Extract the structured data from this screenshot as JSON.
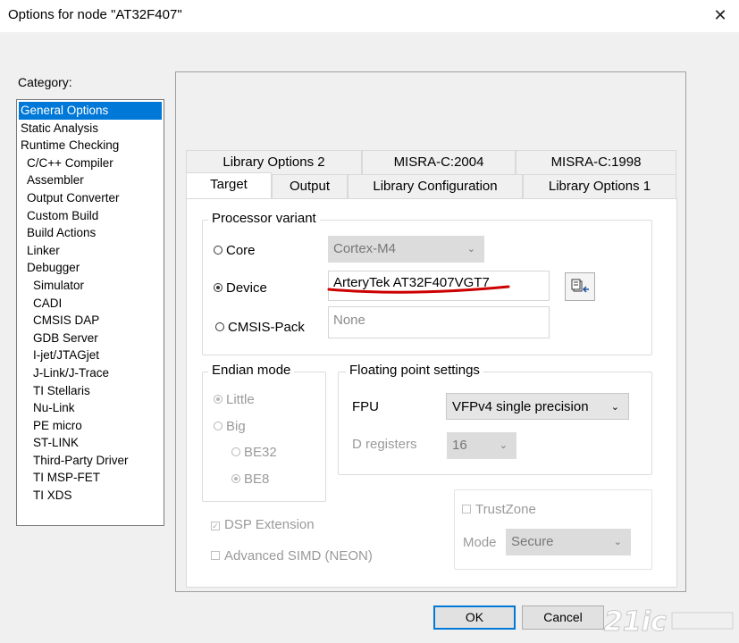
{
  "window": {
    "title": "Options for node \"AT32F407\"",
    "close_symbol": "✕"
  },
  "category": {
    "label": "Category:",
    "items": [
      {
        "label": "General Options",
        "level": 0,
        "selected": true
      },
      {
        "label": "Static Analysis",
        "level": 0
      },
      {
        "label": "Runtime Checking",
        "level": 0
      },
      {
        "label": "C/C++ Compiler",
        "level": 1
      },
      {
        "label": "Assembler",
        "level": 1
      },
      {
        "label": "Output Converter",
        "level": 1
      },
      {
        "label": "Custom Build",
        "level": 1
      },
      {
        "label": "Build Actions",
        "level": 1
      },
      {
        "label": "Linker",
        "level": 1
      },
      {
        "label": "Debugger",
        "level": 1
      },
      {
        "label": "Simulator",
        "level": 2
      },
      {
        "label": "CADI",
        "level": 2
      },
      {
        "label": "CMSIS DAP",
        "level": 2
      },
      {
        "label": "GDB Server",
        "level": 2
      },
      {
        "label": "I-jet/JTAGjet",
        "level": 2
      },
      {
        "label": "J-Link/J-Trace",
        "level": 2
      },
      {
        "label": "TI Stellaris",
        "level": 2
      },
      {
        "label": "Nu-Link",
        "level": 2
      },
      {
        "label": "PE micro",
        "level": 2
      },
      {
        "label": "ST-LINK",
        "level": 2
      },
      {
        "label": "Third-Party Driver",
        "level": 2
      },
      {
        "label": "TI MSP-FET",
        "level": 2
      },
      {
        "label": "TI XDS",
        "level": 2
      }
    ]
  },
  "tabs": {
    "row_back": [
      "Library Options 2",
      "MISRA-C:2004",
      "MISRA-C:1998"
    ],
    "row_front": [
      "Target",
      "Output",
      "Library Configuration",
      "Library Options 1"
    ],
    "active": "Target"
  },
  "processor_variant": {
    "title": "Processor variant",
    "core_label": "Core",
    "core_value": "Cortex-M4",
    "device_label": "Device",
    "device_value": "ArteryTek AT32F407VGT7",
    "cmsis_label": "CMSIS-Pack",
    "cmsis_value": "None",
    "selected": "Device",
    "annotation_color": "#cc0000"
  },
  "endian": {
    "title": "Endian mode",
    "little": "Little",
    "big": "Big",
    "be32": "BE32",
    "be8": "BE8"
  },
  "floating_point": {
    "title": "Floating point settings",
    "fpu_label": "FPU",
    "fpu_value": "VFPv4 single precision",
    "dreg_label": "D registers",
    "dreg_value": "16"
  },
  "options": {
    "dsp_label": "DSP Extension",
    "dsp_checked": true,
    "simd_label": "Advanced SIMD (NEON)",
    "simd_checked": false
  },
  "trustzone": {
    "label": "TrustZone",
    "mode_label": "Mode",
    "mode_value": "Secure"
  },
  "buttons": {
    "ok": "OK",
    "cancel": "Cancel"
  },
  "accent_color": "#0078d7"
}
